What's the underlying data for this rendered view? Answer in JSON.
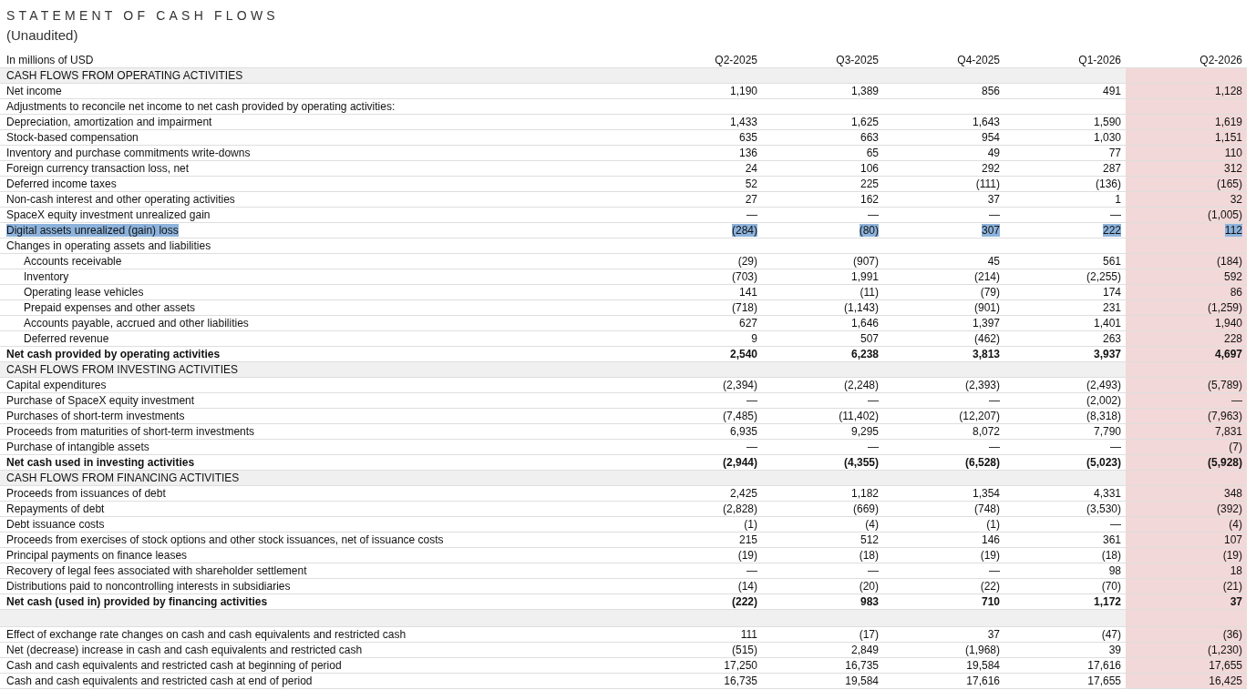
{
  "title": "STATEMENT OF CASH FLOWS",
  "subtitle": "(Unaudited)",
  "table": {
    "unit_label": "In millions of USD",
    "columns": [
      {
        "label": "Q2-2025",
        "highlighted": false
      },
      {
        "label": "Q3-2025",
        "highlighted": false
      },
      {
        "label": "Q4-2025",
        "highlighted": false
      },
      {
        "label": "Q1-2026",
        "highlighted": false
      },
      {
        "label": "Q2-2026",
        "highlighted": true
      }
    ],
    "rows": [
      {
        "kind": "section",
        "label": "CASH FLOWS FROM OPERATING ACTIVITIES",
        "highlighted": false
      },
      {
        "kind": "item",
        "label": "Net income",
        "values": [
          "1,190",
          "1,389",
          "856",
          "491",
          "1,128"
        ],
        "highlighted": false
      },
      {
        "kind": "item",
        "label": "Adjustments to reconcile net income to net cash provided by operating activities:",
        "highlighted": false
      },
      {
        "kind": "item",
        "label": "Depreciation, amortization and impairment",
        "values": [
          "1,433",
          "1,625",
          "1,643",
          "1,590",
          "1,619"
        ],
        "highlighted": false
      },
      {
        "kind": "item",
        "label": "Stock-based compensation",
        "values": [
          "635",
          "663",
          "954",
          "1,030",
          "1,151"
        ],
        "highlighted": false
      },
      {
        "kind": "item",
        "label": "Inventory and purchase commitments write-downs",
        "values": [
          "136",
          "65",
          "49",
          "77",
          "110"
        ],
        "highlighted": false
      },
      {
        "kind": "item",
        "label": "Foreign currency transaction loss, net",
        "values": [
          "24",
          "106",
          "292",
          "287",
          "312"
        ],
        "highlighted": false
      },
      {
        "kind": "item",
        "label": "Deferred income taxes",
        "values": [
          "52",
          "225",
          "(111)",
          "(136)",
          "(165)"
        ],
        "highlighted": false
      },
      {
        "kind": "item",
        "label": "Non-cash interest and other operating activities",
        "values": [
          "27",
          "162",
          "37",
          "1",
          "32"
        ],
        "highlighted": false
      },
      {
        "kind": "item",
        "label": "SpaceX equity investment unrealized gain",
        "values": [
          "—",
          "—",
          "—",
          "—",
          "(1,005)"
        ],
        "highlighted": false
      },
      {
        "kind": "item",
        "label": "Digital assets unrealized (gain) loss",
        "values": [
          "(284)",
          "(80)",
          "307",
          "222",
          "112"
        ],
        "highlighted": true
      },
      {
        "kind": "item",
        "label": "Changes in operating assets and liabilities",
        "highlighted": false
      },
      {
        "kind": "sub",
        "label": "Accounts receivable",
        "values": [
          "(29)",
          "(907)",
          "45",
          "561",
          "(184)"
        ],
        "highlighted": false
      },
      {
        "kind": "sub",
        "label": "Inventory",
        "values": [
          "(703)",
          "1,991",
          "(214)",
          "(2,255)",
          "592"
        ],
        "highlighted": false
      },
      {
        "kind": "sub",
        "label": "Operating lease vehicles",
        "values": [
          "141",
          "(11)",
          "(79)",
          "174",
          "86"
        ],
        "highlighted": false
      },
      {
        "kind": "sub",
        "label": "Prepaid expenses and other assets",
        "values": [
          "(718)",
          "(1,143)",
          "(901)",
          "231",
          "(1,259)"
        ],
        "highlighted": false
      },
      {
        "kind": "sub",
        "label": "Accounts payable, accrued and other liabilities",
        "values": [
          "627",
          "1,646",
          "1,397",
          "1,401",
          "1,940"
        ],
        "highlighted": false
      },
      {
        "kind": "sub",
        "label": "Deferred revenue",
        "values": [
          "9",
          "507",
          "(462)",
          "263",
          "228"
        ],
        "highlighted": false
      },
      {
        "kind": "total",
        "label": "Net cash provided by operating activities",
        "values": [
          "2,540",
          "6,238",
          "3,813",
          "3,937",
          "4,697"
        ],
        "highlighted": false
      },
      {
        "kind": "section",
        "label": "CASH FLOWS FROM INVESTING ACTIVITIES",
        "highlighted": false
      },
      {
        "kind": "item",
        "label": "Capital expenditures",
        "values": [
          "(2,394)",
          "(2,248)",
          "(2,393)",
          "(2,493)",
          "(5,789)"
        ],
        "highlighted": false
      },
      {
        "kind": "item",
        "label": "Purchase of SpaceX equity investment",
        "values": [
          "—",
          "—",
          "—",
          "(2,002)",
          "—"
        ],
        "highlighted": false
      },
      {
        "kind": "item",
        "label": "Purchases of short-term investments",
        "values": [
          "(7,485)",
          "(11,402)",
          "(12,207)",
          "(8,318)",
          "(7,963)"
        ],
        "highlighted": false
      },
      {
        "kind": "item",
        "label": "Proceeds from maturities of short-term investments",
        "values": [
          "6,935",
          "9,295",
          "8,072",
          "7,790",
          "7,831"
        ],
        "highlighted": false
      },
      {
        "kind": "item",
        "label": "Purchase of intangible assets",
        "values": [
          "—",
          "—",
          "—",
          "—",
          "(7)"
        ],
        "highlighted": false
      },
      {
        "kind": "total",
        "label": "Net cash used in investing activities",
        "values": [
          "(2,944)",
          "(4,355)",
          "(6,528)",
          "(5,023)",
          "(5,928)"
        ],
        "highlighted": false
      },
      {
        "kind": "section",
        "label": "CASH FLOWS FROM FINANCING ACTIVITIES",
        "highlighted": false
      },
      {
        "kind": "item",
        "label": "Proceeds from issuances of debt",
        "values": [
          "2,425",
          "1,182",
          "1,354",
          "4,331",
          "348"
        ],
        "highlighted": false
      },
      {
        "kind": "item",
        "label": "Repayments of debt",
        "values": [
          "(2,828)",
          "(669)",
          "(748)",
          "(3,530)",
          "(392)"
        ],
        "highlighted": false
      },
      {
        "kind": "item",
        "label": "Debt issuance costs",
        "values": [
          "(1)",
          "(4)",
          "(1)",
          "—",
          "(4)"
        ],
        "highlighted": false
      },
      {
        "kind": "item",
        "label": "Proceeds from exercises of stock options and other stock issuances, net of issuance costs",
        "values": [
          "215",
          "512",
          "146",
          "361",
          "107"
        ],
        "highlighted": false
      },
      {
        "kind": "item",
        "label": "Principal payments on finance leases",
        "values": [
          "(19)",
          "(18)",
          "(19)",
          "(18)",
          "(19)"
        ],
        "highlighted": false
      },
      {
        "kind": "item",
        "label": "Recovery of legal fees associated with shareholder settlement",
        "values": [
          "—",
          "—",
          "—",
          "98",
          "18"
        ],
        "highlighted": false
      },
      {
        "kind": "item",
        "label": "Distributions paid to noncontrolling interests in subsidiaries",
        "values": [
          "(14)",
          "(20)",
          "(22)",
          "(70)",
          "(21)"
        ],
        "highlighted": false
      },
      {
        "kind": "total",
        "label": "Net cash (used in) provided by financing activities",
        "values": [
          "(222)",
          "983",
          "710",
          "1,172",
          "37"
        ],
        "highlighted": false
      },
      {
        "kind": "spacer"
      },
      {
        "kind": "item",
        "label": "Effect of exchange rate changes on cash and cash equivalents and restricted cash",
        "values": [
          "111",
          "(17)",
          "37",
          "(47)",
          "(36)"
        ],
        "highlighted": false
      },
      {
        "kind": "item",
        "label": "Net (decrease) increase in cash and cash equivalents and restricted cash",
        "values": [
          "(515)",
          "2,849",
          "(1,968)",
          "39",
          "(1,230)"
        ],
        "highlighted": false
      },
      {
        "kind": "item",
        "label": "Cash and cash equivalents and restricted cash at beginning of period",
        "values": [
          "17,250",
          "16,735",
          "19,584",
          "17,616",
          "17,655"
        ],
        "highlighted": false
      },
      {
        "kind": "item",
        "label": "Cash and cash equivalents and restricted cash at end of period",
        "values": [
          "16,735",
          "19,584",
          "17,616",
          "17,655",
          "16,425"
        ],
        "highlighted": false
      }
    ]
  }
}
